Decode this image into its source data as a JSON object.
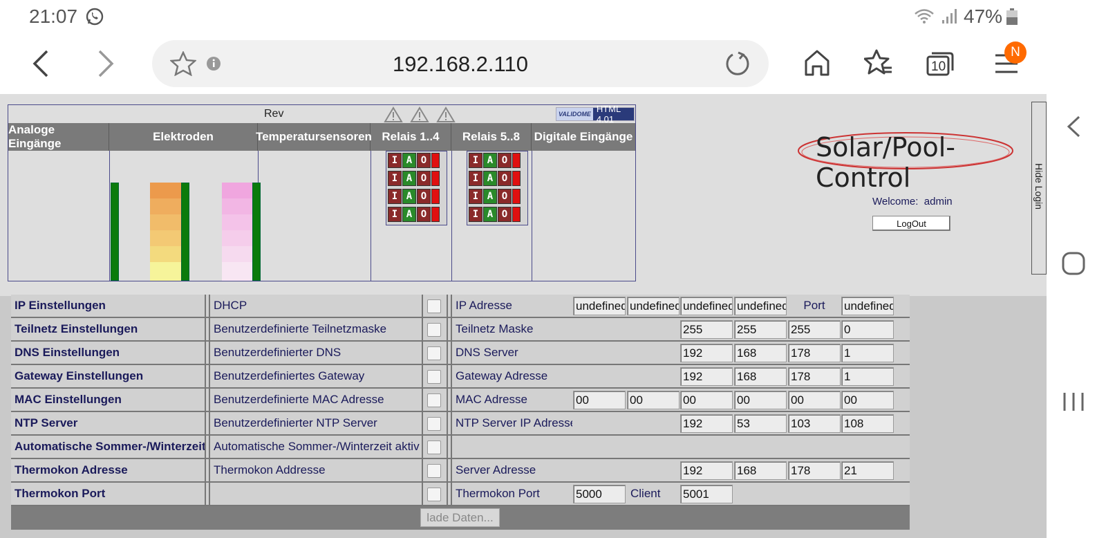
{
  "status_bar": {
    "time": "21:07",
    "battery": "47%",
    "icons": [
      "whatsapp-icon",
      "wifi-icon",
      "signal-icon",
      "battery-icon"
    ]
  },
  "browser": {
    "url": "192.168.2.110",
    "tabs_count": "10",
    "profile_badge": "N"
  },
  "header": {
    "rev_label": "Rev",
    "validator_small": "VALIDOME",
    "validator_big": "HTML 4.01",
    "columns": [
      "Analoge Eingänge",
      "Elektroden",
      "Temperatursensoren",
      "Relais 1..4",
      "Relais 5..8",
      "Digitale Eingänge"
    ],
    "relay_buttons": [
      "I",
      "A",
      "O"
    ]
  },
  "login": {
    "welcome_label": "Welcome:",
    "user": "admin",
    "logout": "LogOut",
    "hide_login": "Hide Login",
    "logo_text": "Solar/Pool-Control"
  },
  "rows": [
    {
      "name": "IP Einstellungen",
      "option": "DHCP",
      "field": "IP Adresse",
      "v": [
        "undefined",
        "undefined",
        "undefined",
        "undefined"
      ],
      "port_label": "Port",
      "port": "undefined"
    },
    {
      "name": "Teilnetz Einstellungen",
      "option": "Benutzerdefinierte Teilnetzmaske",
      "field": "Teilnetz Maske",
      "v": [
        "255",
        "255",
        "255",
        "0"
      ]
    },
    {
      "name": "DNS Einstellungen",
      "option": "Benutzerdefinierter DNS",
      "field": "DNS Server",
      "v": [
        "192",
        "168",
        "178",
        "1"
      ]
    },
    {
      "name": "Gateway Einstellungen",
      "option": "Benutzerdefiniertes Gateway",
      "field": "Gateway Adresse",
      "v": [
        "192",
        "168",
        "178",
        "1"
      ]
    },
    {
      "name": "MAC Einstellungen",
      "option": "Benutzerdefinierte MAC Adresse",
      "field": "MAC Adresse",
      "v": [
        "00",
        "00",
        "00",
        "00",
        "00",
        "00"
      ]
    },
    {
      "name": "NTP Server",
      "option": "Benutzerdefinierter NTP Server",
      "field": "NTP Server IP Adresse",
      "v": [
        "192",
        "53",
        "103",
        "108"
      ]
    },
    {
      "name": "Automatische Sommer-/Winterzeit",
      "option": "Automatische Sommer-/Winterzeit aktiv",
      "field": "",
      "v": []
    },
    {
      "name": "Thermokon Adresse",
      "option": "Thermokon Addresse",
      "field": "Server Adresse",
      "v": [
        "192",
        "168",
        "178",
        "21"
      ]
    },
    {
      "name": "Thermokon Port",
      "option": "",
      "field": "Thermokon Port",
      "port_server": "5000",
      "client_label": "Client",
      "port_client": "5001"
    }
  ],
  "footer": {
    "load_button": "lade Daten..."
  }
}
